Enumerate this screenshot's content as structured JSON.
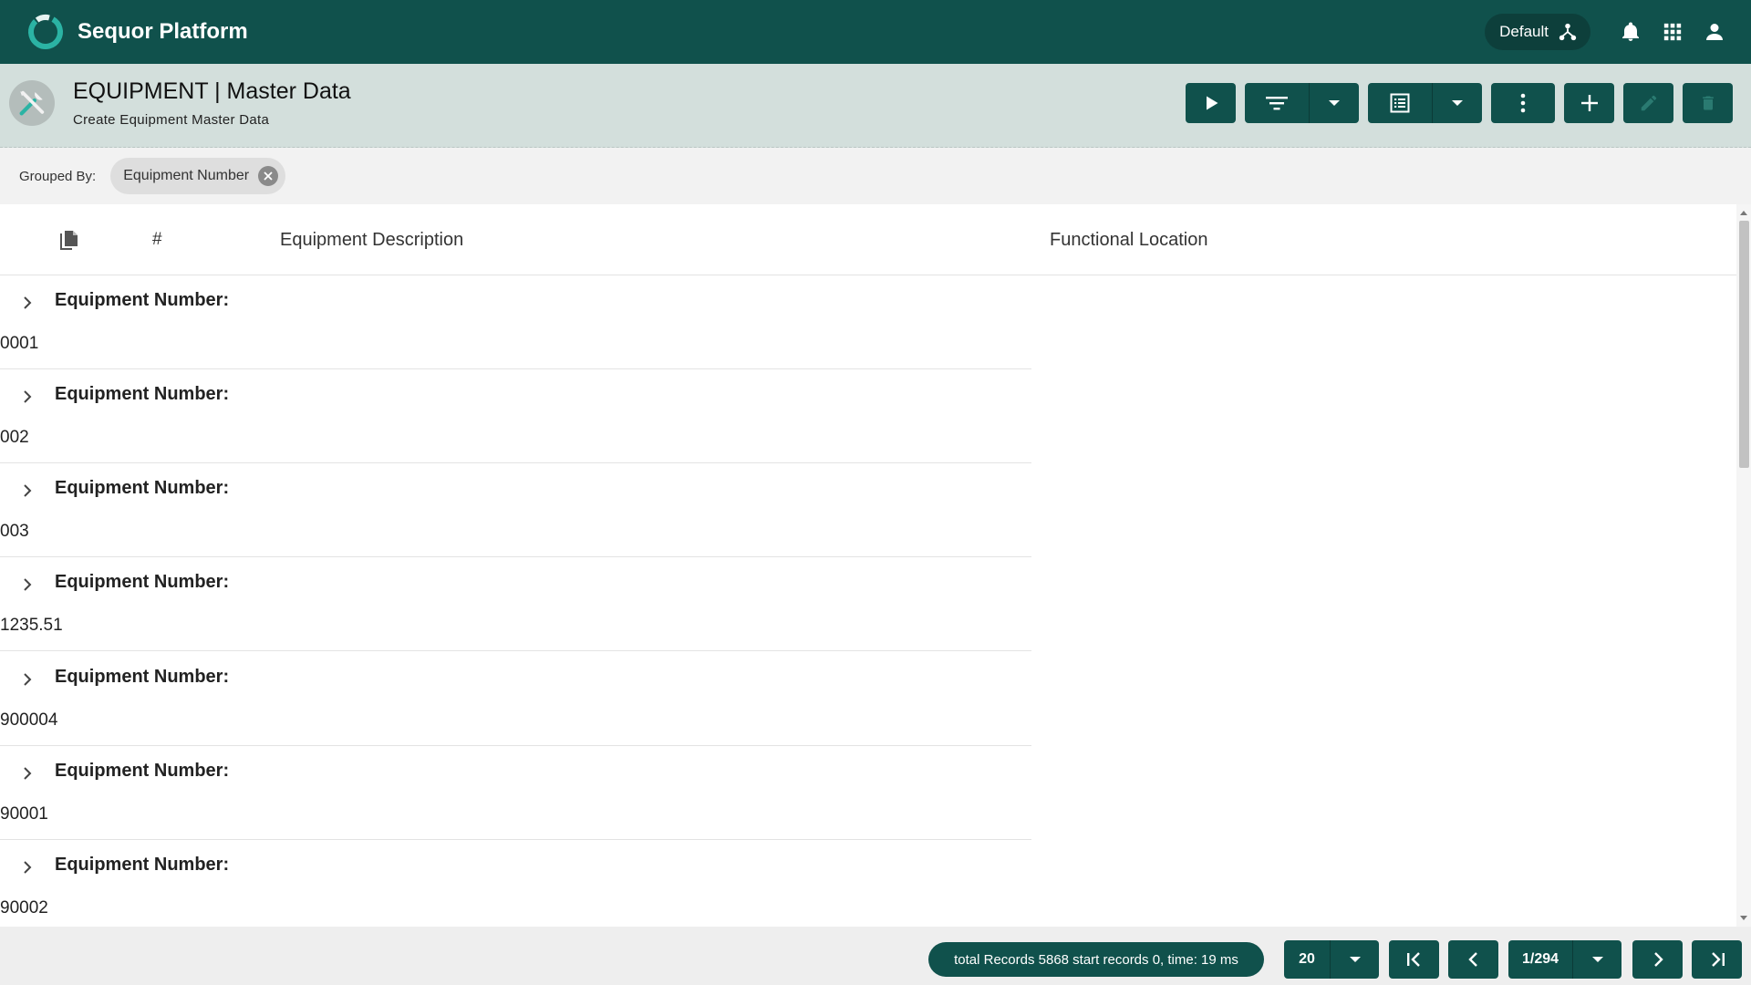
{
  "app": {
    "title": "Sequor Platform",
    "workspace": "Default",
    "colors": {
      "primary": "#10514c",
      "header_bg": "#d3dfdc",
      "accent": "#2bb3a4"
    }
  },
  "page": {
    "title": "EQUIPMENT | Master Data",
    "subtitle": "Create Equipment Master Data",
    "icon": "tools-icon"
  },
  "toolbar": {
    "buttons": [
      "play-icon",
      "filter-icon",
      "list-view-icon",
      "more-vert-icon",
      "add-icon",
      "edit-icon",
      "delete-icon"
    ]
  },
  "grouping": {
    "label": "Grouped By:",
    "chip": "Equipment Number"
  },
  "grid": {
    "columns": {
      "copy": "copy-icon",
      "hash": "#",
      "description": "Equipment Description",
      "location": "Functional Location"
    },
    "group_label": "Equipment Number:",
    "groups": [
      {
        "label": "Equipment Number:",
        "value": "0001"
      },
      {
        "label": "Equipment Number:",
        "value": "002"
      },
      {
        "label": "Equipment Number:",
        "value": "003"
      },
      {
        "label": "Equipment Number:",
        "value": "1235.51"
      },
      {
        "label": "Equipment Number:",
        "value": "900004"
      },
      {
        "label": "Equipment Number:",
        "value": "90001"
      },
      {
        "label": "Equipment Number:",
        "value": "90002"
      }
    ]
  },
  "footer": {
    "status": "total Records 5868 start records 0, time: 19 ms",
    "page_size": "20",
    "page_indicator": "1/294"
  }
}
